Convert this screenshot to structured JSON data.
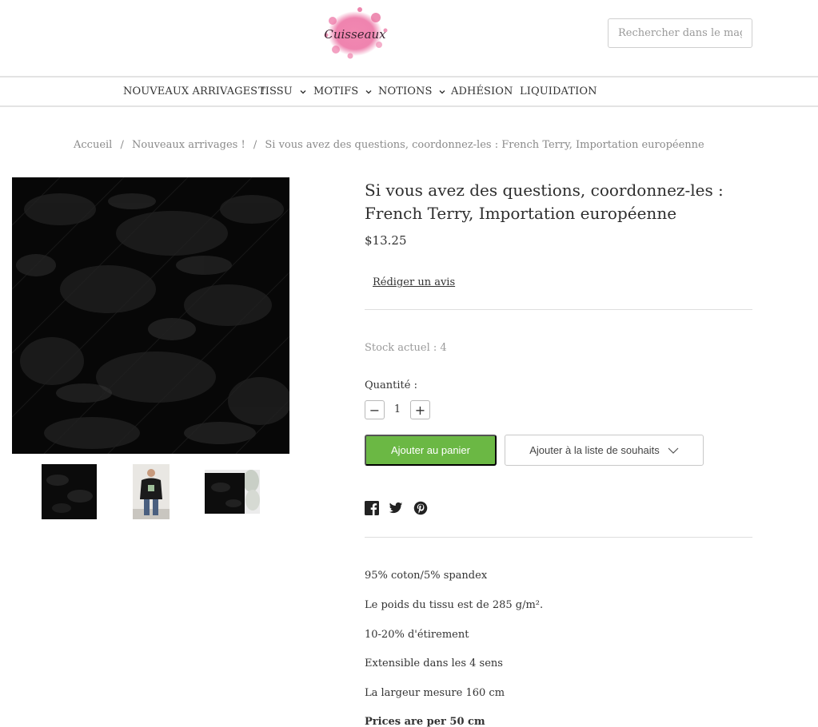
{
  "header": {
    "logo_text": "Cuisseaux",
    "search_placeholder": "Rechercher dans le magasin"
  },
  "nav": {
    "items": [
      {
        "label": "NOUVEAUX ARRIVAGES !",
        "has_dropdown": false
      },
      {
        "label": "TISSU",
        "has_dropdown": true
      },
      {
        "label": "MOTIFS",
        "has_dropdown": true
      },
      {
        "label": "NOTIONS",
        "has_dropdown": true
      },
      {
        "label": "ADHÉSION",
        "has_dropdown": false
      },
      {
        "label": "LIQUIDATION",
        "has_dropdown": false
      }
    ]
  },
  "breadcrumb": {
    "items": [
      "Accueil",
      "Nouveaux arrivages !",
      "Si vous avez des questions, coordonnez-les : French Terry, Importation européenne"
    ],
    "separator": "/"
  },
  "product": {
    "title": "Si vous avez des questions, coordonnez-les : French Terry, Importation européenne",
    "price": "$13.25",
    "review_link": "Rédiger un avis",
    "stock": "Stock actuel : 4",
    "quantity_label": "Quantité :",
    "quantity_value": "1",
    "quantity_decrease": "−",
    "quantity_increase": "+",
    "add_to_cart": "Ajouter au panier",
    "add_to_wishlist": "Ajouter à la liste de souhaits",
    "description": [
      "95% coton/5% spandex",
      "Le poids du tissu est de 285 g/m².",
      "10-20% d'étirement",
      "Extensible dans les 4 sens",
      "La largeur mesure 160 cm",
      "Prices are per 50 cm"
    ]
  },
  "colors": {
    "accent_green": "#6bb844",
    "logo_pink": "#e8689a",
    "border": "#dedede",
    "muted_text": "#9a9a9a"
  },
  "icons": {
    "social": [
      "facebook-icon",
      "twitter-icon",
      "pinterest-icon"
    ]
  }
}
